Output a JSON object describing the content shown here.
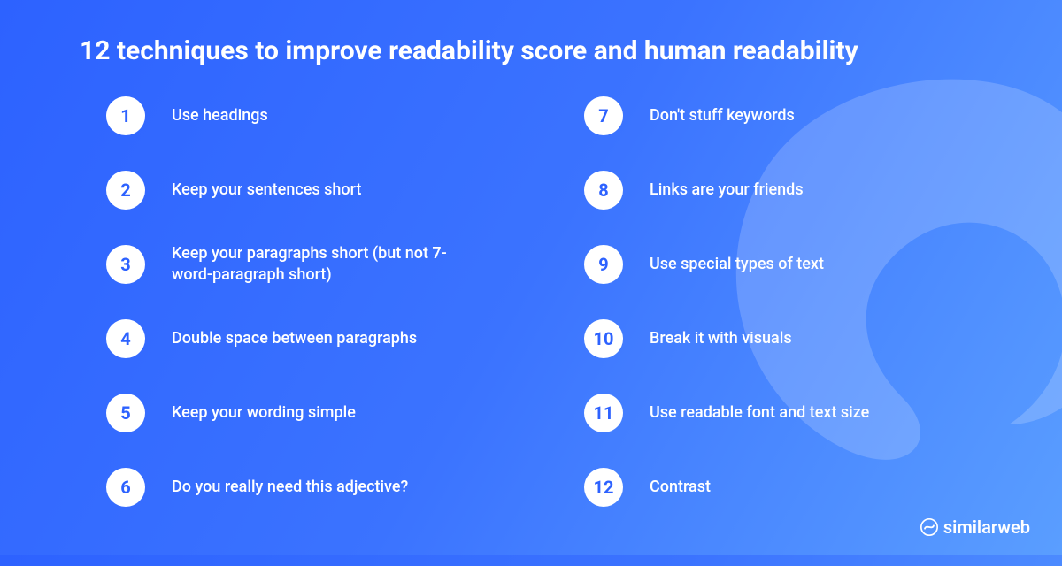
{
  "title": "12 techniques to improve readability score and human readability",
  "left": [
    {
      "n": "1",
      "label": "Use headings"
    },
    {
      "n": "2",
      "label": "Keep your sentences short"
    },
    {
      "n": "3",
      "label": "Keep your paragraphs short (but not 7-word-paragraph short)"
    },
    {
      "n": "4",
      "label": "Double space between paragraphs"
    },
    {
      "n": "5",
      "label": "Keep your wording simple"
    },
    {
      "n": "6",
      "label": "Do you really need this adjective?"
    }
  ],
  "right": [
    {
      "n": "7",
      "label": "Don't stuff keywords"
    },
    {
      "n": "8",
      "label": "Links are your friends"
    },
    {
      "n": "9",
      "label": "Use special types of text"
    },
    {
      "n": "10",
      "label": "Break it with visuals"
    },
    {
      "n": "11",
      "label": "Use readable font and text size"
    },
    {
      "n": "12",
      "label": "Contrast"
    }
  ],
  "brand": "similarweb"
}
